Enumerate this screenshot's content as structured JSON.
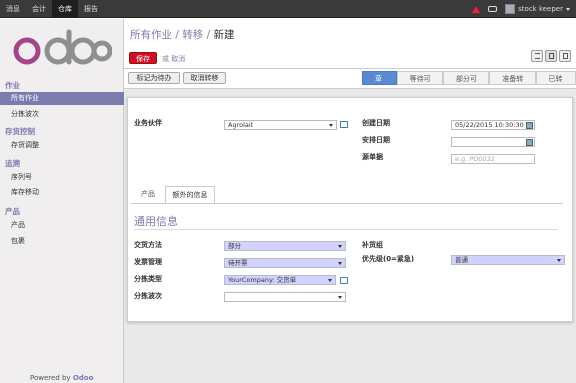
{
  "topbar": {
    "menu": [
      "消息",
      "会计",
      "仓库",
      "报告"
    ],
    "active_menu": "仓库",
    "user": "stock keeper"
  },
  "sidebar": {
    "logo": "odoo",
    "sections": [
      {
        "title": "作业",
        "items": [
          "所有作业",
          "分拣波次"
        ]
      },
      {
        "title": "存货控制",
        "items": [
          "存货调整"
        ]
      },
      {
        "title": "追溯",
        "items": [
          "序列号",
          "库存移动"
        ]
      },
      {
        "title": "产品",
        "items": [
          "产品",
          "包裹"
        ]
      }
    ],
    "active_item": "所有作业",
    "powered_prefix": "Powered by",
    "powered_brand": "Odoo"
  },
  "breadcrumb": {
    "part1": "所有作业",
    "sep1": "/",
    "part2": "转移",
    "sep2": "/",
    "current": "新建"
  },
  "toolbar": {
    "save_label": "保存",
    "or_label": "或",
    "discard_label": "取消"
  },
  "actions": {
    "mark_todo": "标记为待办",
    "cancel_transfer": "取消转移"
  },
  "statusbar": [
    "草稿",
    "等待可用",
    "部分可用",
    "准备转移",
    "已转移"
  ],
  "status_current": "草稿",
  "form": {
    "partner_label": "业务伙伴",
    "partner_value": "Agrolait",
    "create_date_label": "创建日期",
    "create_date_value": "05/22/2015 10:30:30",
    "scheduled_label": "安排日期",
    "scheduled_value": "",
    "source_label": "源单据",
    "source_placeholder": "e.g. PO0032"
  },
  "tabs": [
    "产品",
    "额外的信息"
  ],
  "active_tab": "额外的信息",
  "extra": {
    "section_title": "通用信息",
    "delivery_label": "交货方法",
    "delivery_value": "部分",
    "invoice_label": "发票管理",
    "invoice_value": "待开票",
    "picking_type_label": "分拣类型",
    "picking_type_value": "YourCompany: 交货单",
    "wave_label": "分拣波次",
    "wave_value": "",
    "procurement_label": "补货组",
    "priority_label": "优先级(0=紧急)",
    "priority_value": "普通"
  }
}
